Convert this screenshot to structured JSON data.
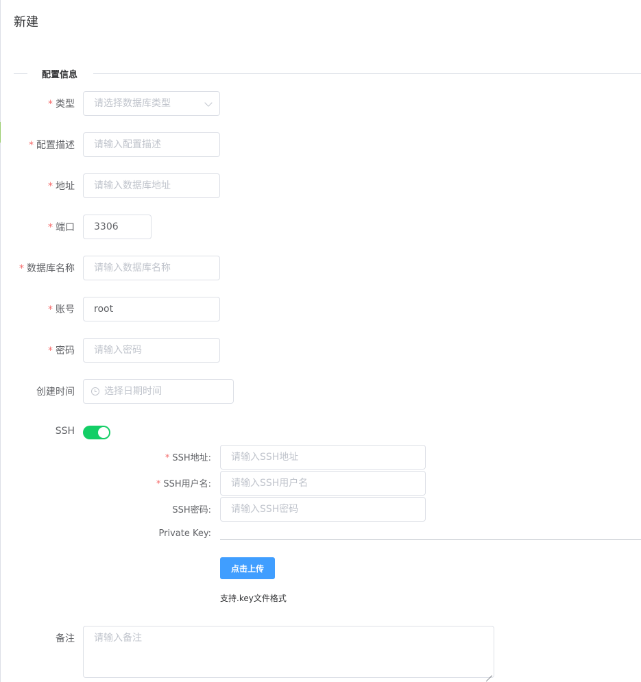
{
  "dialog": {
    "title": "新建"
  },
  "section": {
    "title": "配置信息"
  },
  "form": {
    "type": {
      "label": "类型",
      "placeholder": "请选择数据库类型",
      "required": true
    },
    "description": {
      "label": "配置描述",
      "placeholder": "请输入配置描述",
      "required": true
    },
    "address": {
      "label": "地址",
      "placeholder": "请输入数据库地址",
      "required": true
    },
    "port": {
      "label": "端口",
      "value": "3306",
      "required": true
    },
    "db_name": {
      "label": "数据库名称",
      "placeholder": "请输入数据库名称",
      "required": true
    },
    "account": {
      "label": "账号",
      "value": "root",
      "required": true
    },
    "password": {
      "label": "密码",
      "placeholder": "请输入密码",
      "required": true
    },
    "created_time": {
      "label": "创建时间",
      "placeholder": "选择日期时间"
    },
    "ssh": {
      "label": "SSH",
      "enabled": true
    },
    "ssh_address": {
      "label": "SSH地址:",
      "placeholder": "请输入SSH地址",
      "required": true
    },
    "ssh_user": {
      "label": "SSH用户名:",
      "placeholder": "请输入SSH用户名",
      "required": true
    },
    "ssh_password": {
      "label": "SSH密码:",
      "placeholder": "请输入SSH密码"
    },
    "private_key": {
      "label": "Private Key:",
      "upload_button": "点击上传",
      "tip": "支持.key文件格式"
    },
    "remark": {
      "label": "备注",
      "placeholder": "请输入备注"
    }
  },
  "colors": {
    "required": "#f56c6c",
    "switch_on": "#13ce66",
    "primary": "#409eff"
  },
  "icons": {
    "select": "chevron-down-icon",
    "datetime": "clock-icon"
  }
}
